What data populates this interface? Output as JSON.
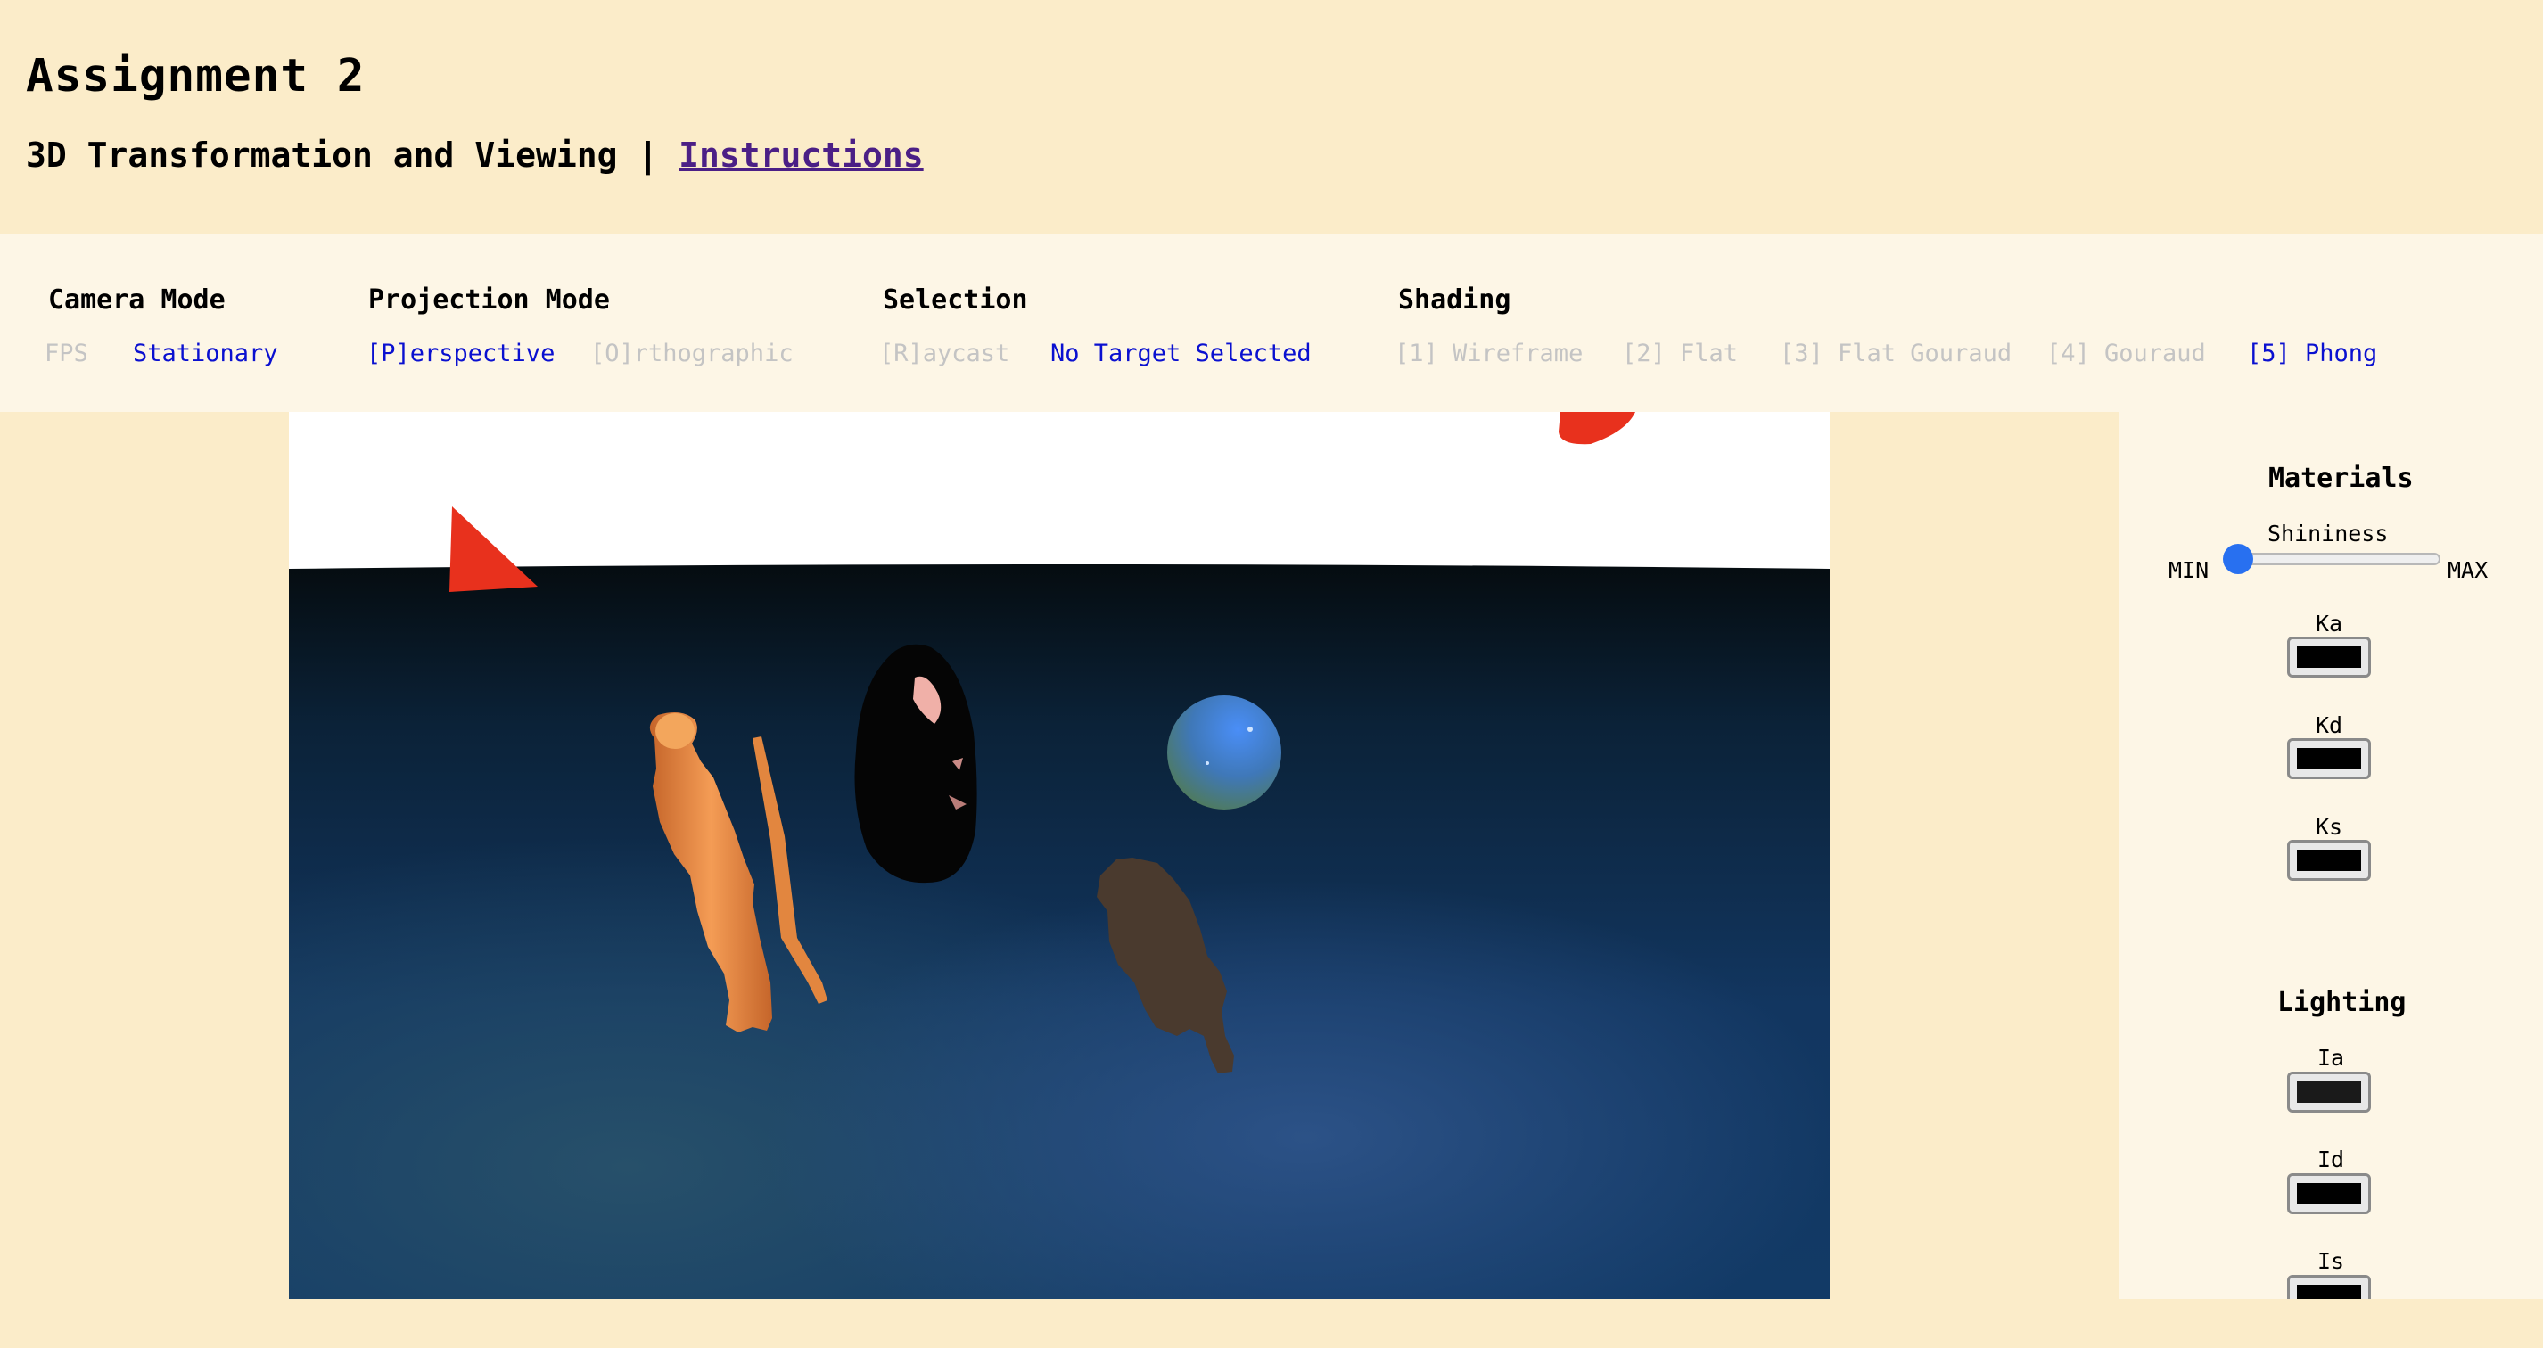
{
  "header": {
    "title": "Assignment 2",
    "subtitle": "3D Transformation and Viewing |",
    "instructions_link": "Instructions"
  },
  "toolbar": {
    "camera_mode": {
      "label": "Camera Mode",
      "options": [
        {
          "label": "FPS",
          "active": false
        },
        {
          "label": "Stationary",
          "active": true
        }
      ]
    },
    "projection_mode": {
      "label": "Projection Mode",
      "options": [
        {
          "label": "[P]erspective",
          "active": true
        },
        {
          "label": "[O]rthographic",
          "active": false
        }
      ]
    },
    "selection": {
      "label": "Selection",
      "options": [
        {
          "label": "[R]aycast",
          "active": false
        },
        {
          "label": "No Target Selected",
          "active": true
        }
      ]
    },
    "shading": {
      "label": "Shading",
      "options": [
        {
          "label": "[1] Wireframe",
          "active": false
        },
        {
          "label": "[2] Flat",
          "active": false
        },
        {
          "label": "[3] Flat Gouraud",
          "active": false
        },
        {
          "label": "[4] Gouraud",
          "active": false
        },
        {
          "label": "[5] Phong",
          "active": true
        }
      ]
    }
  },
  "materials": {
    "title": "Materials",
    "shininess": {
      "label": "Shininess",
      "min_label": "MIN",
      "max_label": "MAX",
      "value_fraction": 0.0
    },
    "ka": {
      "label": "Ka",
      "color": "#000000"
    },
    "kd": {
      "label": "Kd",
      "color": "#000000"
    },
    "ks": {
      "label": "Ks",
      "color": "#000000"
    }
  },
  "lighting": {
    "title": "Lighting",
    "ia": {
      "label": "Ia",
      "color": "#1a1a1a"
    },
    "id": {
      "label": "Id",
      "color": "#000000"
    },
    "is": {
      "label": "Is",
      "color": "#000000"
    }
  },
  "colors": {
    "active_option": "#0a10d0",
    "inactive_option": "#c4c4c4",
    "link": "#4b1f86",
    "slider_thumb": "#2870f0",
    "page_background": "#fbecc9"
  }
}
